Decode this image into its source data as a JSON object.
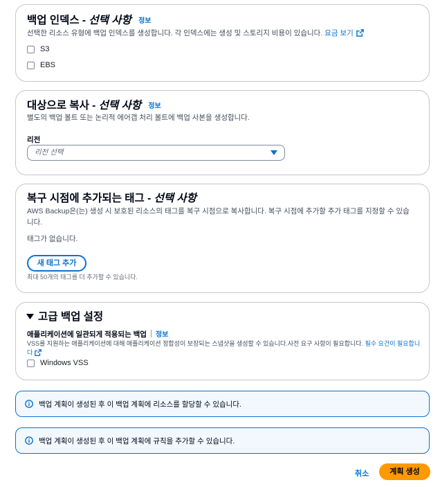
{
  "backup_index": {
    "title": "백업 인덱스 - ",
    "title_optional": "선택 사항",
    "info": "정보",
    "description": "선택한 리소스 유형에 백업 인덱스를 생성합니다. 각 인덱스에는 생성 및 스토리지 비용이 있습니다. ",
    "pricing_link": "요금 보기",
    "options": [
      "S3",
      "EBS"
    ]
  },
  "copy_to_destination": {
    "title": "대상으로 복사 - ",
    "title_optional": "선택 사항",
    "info": "정보",
    "description": "별도의 백업 볼트 또는 논리적 에어갭 처리 볼트에 백업 사본을 생성합니다.",
    "region_label": "리전",
    "region_placeholder": "리전 선택"
  },
  "recovery_point_tags": {
    "title": "복구 시점에 추가되는 태그 - ",
    "title_optional": "선택 사항",
    "description": "AWS Backup은(는) 생성 시 보호된 리소스의 태그를 복구 시점으로 복사합니다. 복구 시점에 추가할 추가 태그를 지정할 수 있습니다.",
    "empty_text": "태그가 없습니다.",
    "add_button": "새 태그 추가",
    "hint": "최대 50개의 태그를 더 추가할 수 있습니다."
  },
  "advanced_settings": {
    "title": "고급 백업 설정",
    "subtitle": "애플리케이션에 일관되게 적용되는 백업",
    "info": "정보",
    "description": "VSS를 지원하는 애플리케이션에 대해 애플리케이션 정합성이 보장되는 스냅샷을 생성할 수 있습니다.사전 요구 사항이 필요합니다. ",
    "prereq_link": "필수 요건이 필요합니다",
    "option": "Windows VSS"
  },
  "alerts": [
    "백업 계획이 생성된 후 이 백업 계획에 리소스를 할당할 수 있습니다.",
    "백업 계획이 생성된 후 이 백업 계획에 규칙을 추가할 수 있습니다."
  ],
  "footer": {
    "cancel": "취소",
    "create": "계획 생성"
  },
  "colors": {
    "link": "#0972d3",
    "primary": "#ff9900",
    "border": "#c6c6cd",
    "alert_bg": "#f2f8fd"
  }
}
